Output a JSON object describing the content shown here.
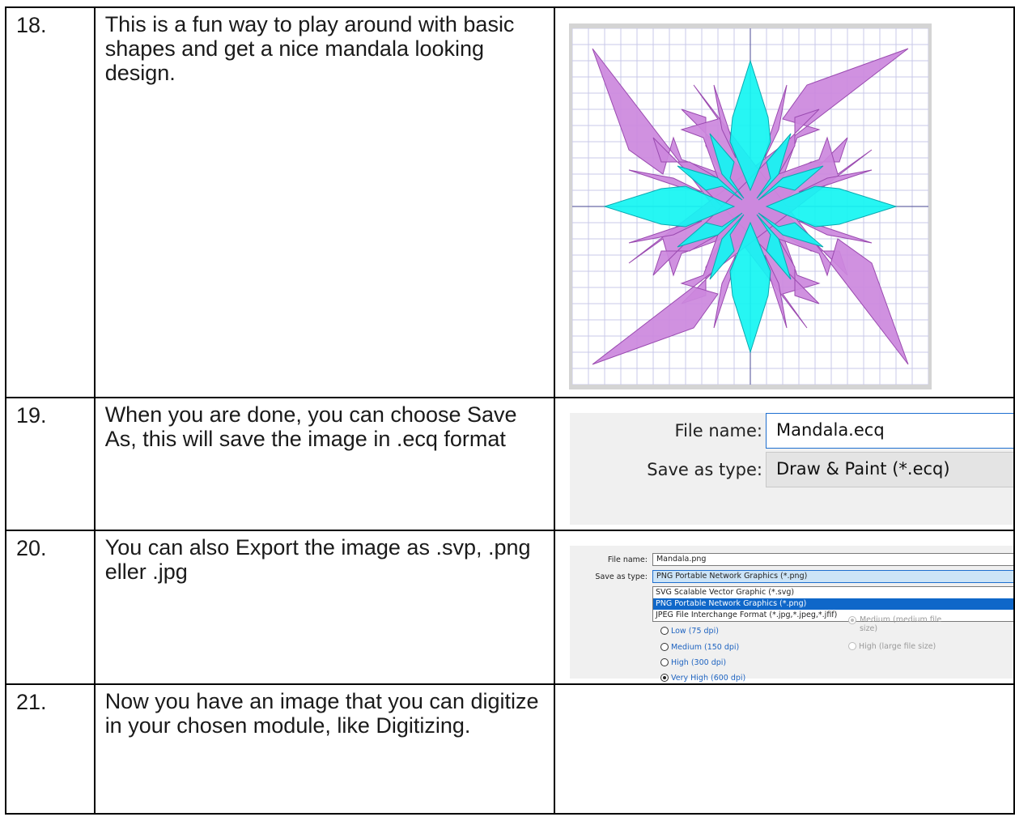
{
  "steps": [
    {
      "number": "18.",
      "text": "This is a fun way to play around with basic shapes and get a nice mandala looking design."
    },
    {
      "number": "19.",
      "text": "When you are done, you can choose Save As, this will save the image in .ecq format"
    },
    {
      "number": "20.",
      "text": "You can also Export the image as .svp, .png eller .jpg"
    },
    {
      "number": "21.",
      "text": "Now you have an image that you can digitize in your chosen module, like Digitizing."
    }
  ],
  "mandala": {
    "outer_color": "#cc88dd",
    "outer_stroke": "#9a4ab0",
    "inner_color": "#14f5f2",
    "inner_stroke": "#0aa8b0",
    "grid_color": "#c8c8e8",
    "axis_color": "#6a6aa8"
  },
  "save_dialog": {
    "file_name_label": "File name:",
    "file_name_value": "Mandala.ecq",
    "save_type_label": "Save as type:",
    "save_type_value": "Draw & Paint (*.ecq)"
  },
  "export_dialog": {
    "file_name_label": "File name:",
    "file_name_value": "Mandala.png",
    "save_type_label": "Save as type:",
    "save_type_value": "PNG Portable Network Graphics (*.png)",
    "options": [
      "SVG Scalable Vector Graphic (*.svg)",
      "PNG Portable Network Graphics (*.png)",
      "JPEG File Interchange Format (*.jpg,*.jpeg,*.jfif)"
    ],
    "selected_option": 1,
    "resolution_options": [
      "Low (75 dpi)",
      "Medium (150 dpi)",
      "High (300 dpi)",
      "Very High (600 dpi)"
    ],
    "resolution_selected": 3,
    "quality_options": [
      "Medium (medium file size)",
      "High (large file size)"
    ],
    "quality_selected": 0
  }
}
